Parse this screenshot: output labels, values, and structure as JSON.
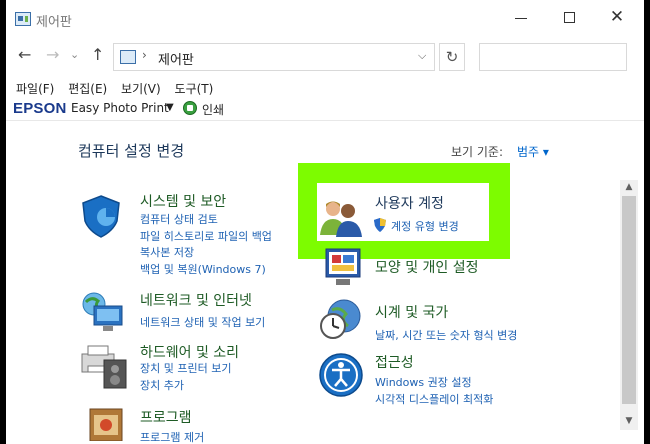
{
  "window": {
    "title": "제어판"
  },
  "address": {
    "path": "제어판",
    "separator": "›"
  },
  "menu": [
    "파일(F)",
    "편집(E)",
    "보기(V)",
    "도구(T)"
  ],
  "epson": {
    "logo": "EPSON",
    "app": "Easy Photo Print",
    "print": "인쇄"
  },
  "header": {
    "title": "컴퓨터 설정 변경",
    "viewby_label": "보기 기준:",
    "viewby_value": "범주 ▾"
  },
  "categories": [
    {
      "title": "시스템 및 보안",
      "links": [
        "컴퓨터 상태 검토",
        "파일 히스토리로 파일의 백업",
        "복사본 저장",
        "백업 및 복원(Windows 7)"
      ]
    },
    {
      "title": "네트워크 및 인터넷",
      "links": [
        "네트워크 상태 및 작업 보기"
      ]
    },
    {
      "title": "하드웨어 및 소리",
      "links": [
        "장치 및 프린터 보기",
        "장치 추가"
      ]
    },
    {
      "title": "프로그램",
      "links": [
        "프로그램 제거"
      ]
    },
    {
      "title": "사용자 계정",
      "links": [
        "계정 유형 변경"
      ]
    },
    {
      "title": "모양 및 개인 설정",
      "links": []
    },
    {
      "title": "시계 및 국가",
      "links": [
        "날짜, 시간 또는 숫자 형식 변경"
      ]
    },
    {
      "title": "접근성",
      "links": [
        "Windows 권장 설정",
        "시각적 디스플레이 최적화"
      ]
    }
  ],
  "colors": {
    "highlight": "#7dfc00",
    "link": "#1f62b3",
    "category_title": "#1e5b25",
    "epson_blue": "#1a3a8c"
  }
}
